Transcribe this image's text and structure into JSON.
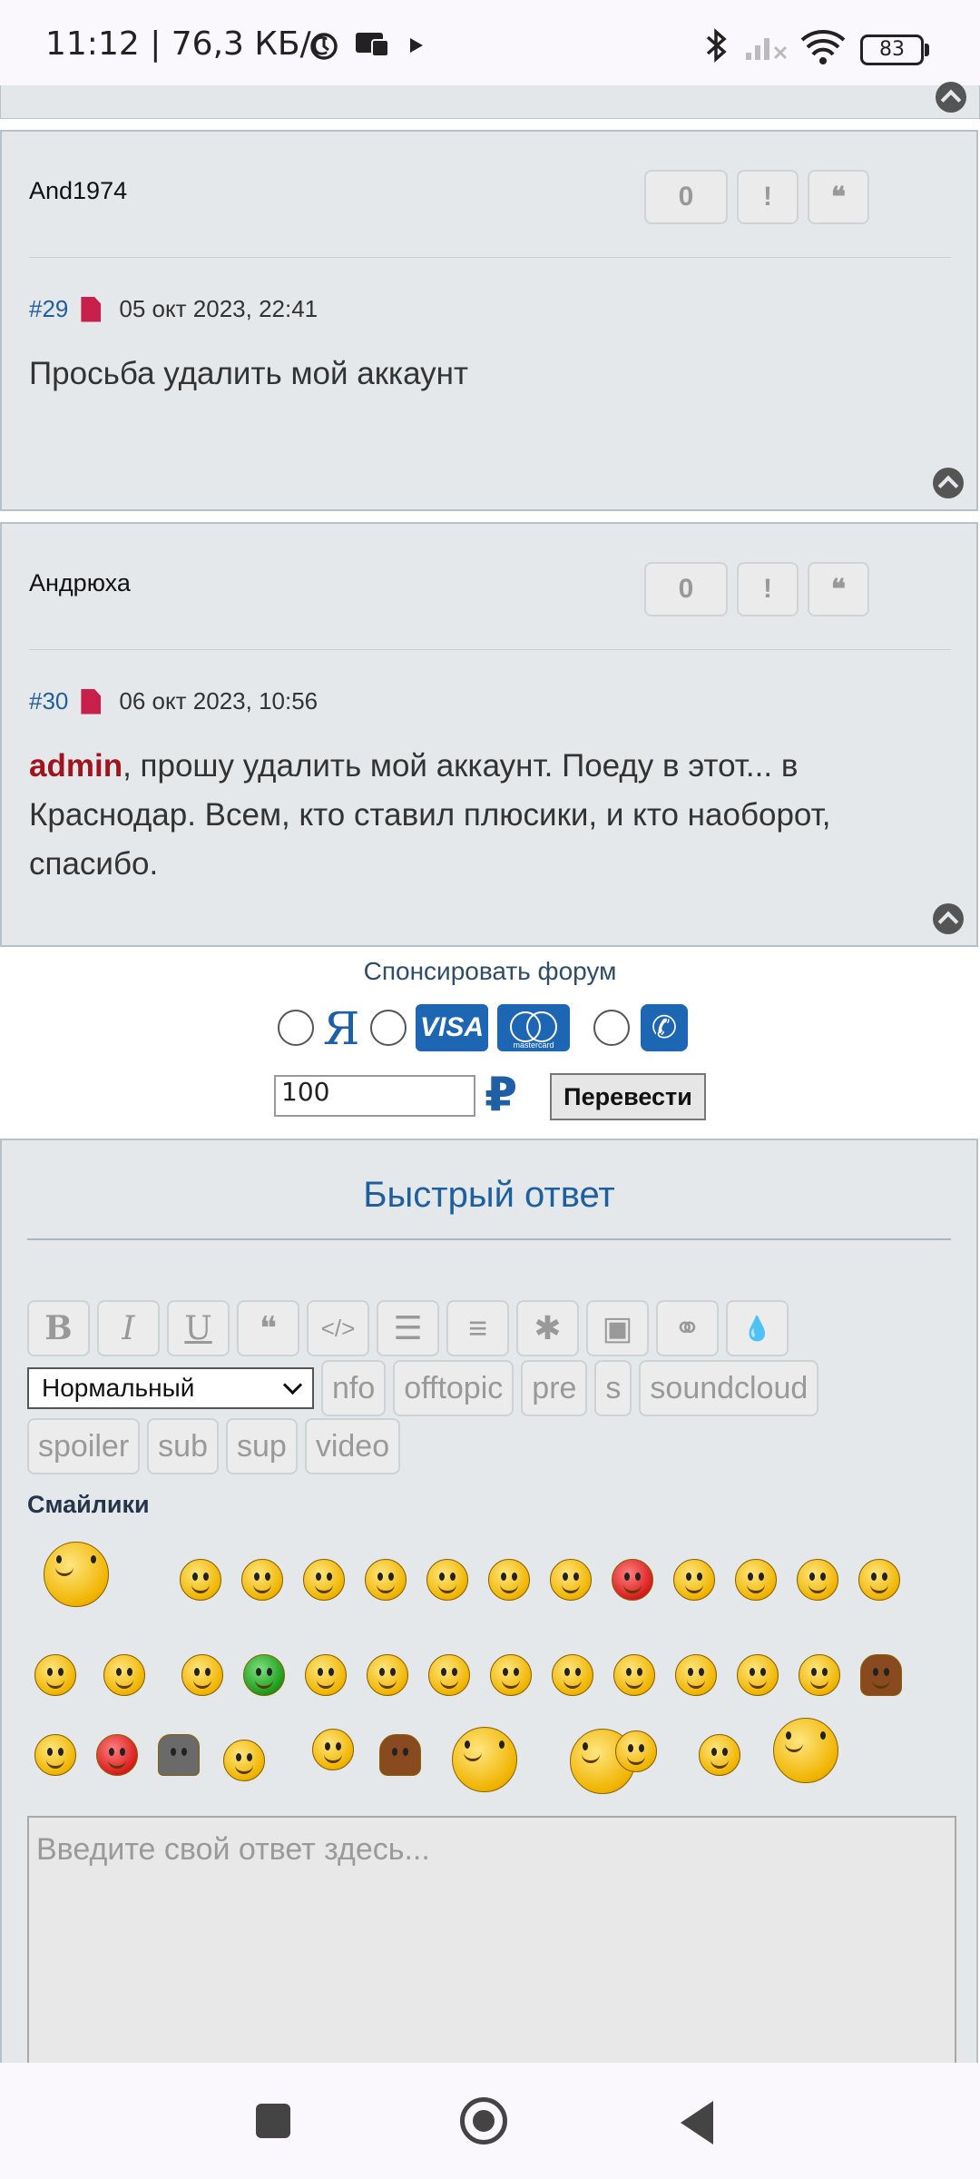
{
  "status_bar": {
    "time_speed": "11:12 | 76,3 КБ/с",
    "battery": "83",
    "icons": [
      "alarm-icon",
      "vpn-icon",
      "play-icon",
      "bluetooth-icon",
      "signal-icon",
      "wifi-icon",
      "battery-icon"
    ]
  },
  "posts": [
    {
      "author": "And1974",
      "likes": "0",
      "report_label": "!",
      "quote_label": "❝",
      "number": "#29",
      "datetime": "05 окт 2023, 22:41",
      "body_text": "Просьба удалить мой аккаунт"
    },
    {
      "author": "Андрюха",
      "likes": "0",
      "report_label": "!",
      "quote_label": "❝",
      "number": "#30",
      "datetime": "06 окт 2023, 10:56",
      "mention": "admin",
      "body_text": ", прошу удалить мой аккаунт. Поеду в этот... в Краснодар. Всем, кто ставил плюсики, и кто наоборот, спасибо."
    }
  ],
  "sponsor": {
    "title": "Спонсировать форум",
    "yandex_label": "Я",
    "visa_label": "VISA",
    "mastercard_label": "mastercard",
    "amount": "100",
    "currency": "₽",
    "transfer_button": "Перевести"
  },
  "quick_reply": {
    "title": "Быстрый ответ",
    "toolbar": [
      "B",
      "I",
      "U",
      "❝",
      "</>",
      "☰",
      "≡",
      "✱",
      "▣",
      "⚭",
      "💧"
    ],
    "font_size_selected": "Нормальный",
    "tags_row1": [
      "nfo",
      "offtopic",
      "pre",
      "s",
      "soundcloud"
    ],
    "tags_row2": [
      "spoiler",
      "sub",
      "sup",
      "video"
    ],
    "smilies_title": "Смайлики",
    "placeholder": "Введите свой ответ здесь..."
  },
  "colors": {
    "post_bg": "#e4e8eb",
    "link_blue": "#1f5f9a",
    "mention_red": "#a0141e",
    "brand_blue": "#1d66b3"
  }
}
